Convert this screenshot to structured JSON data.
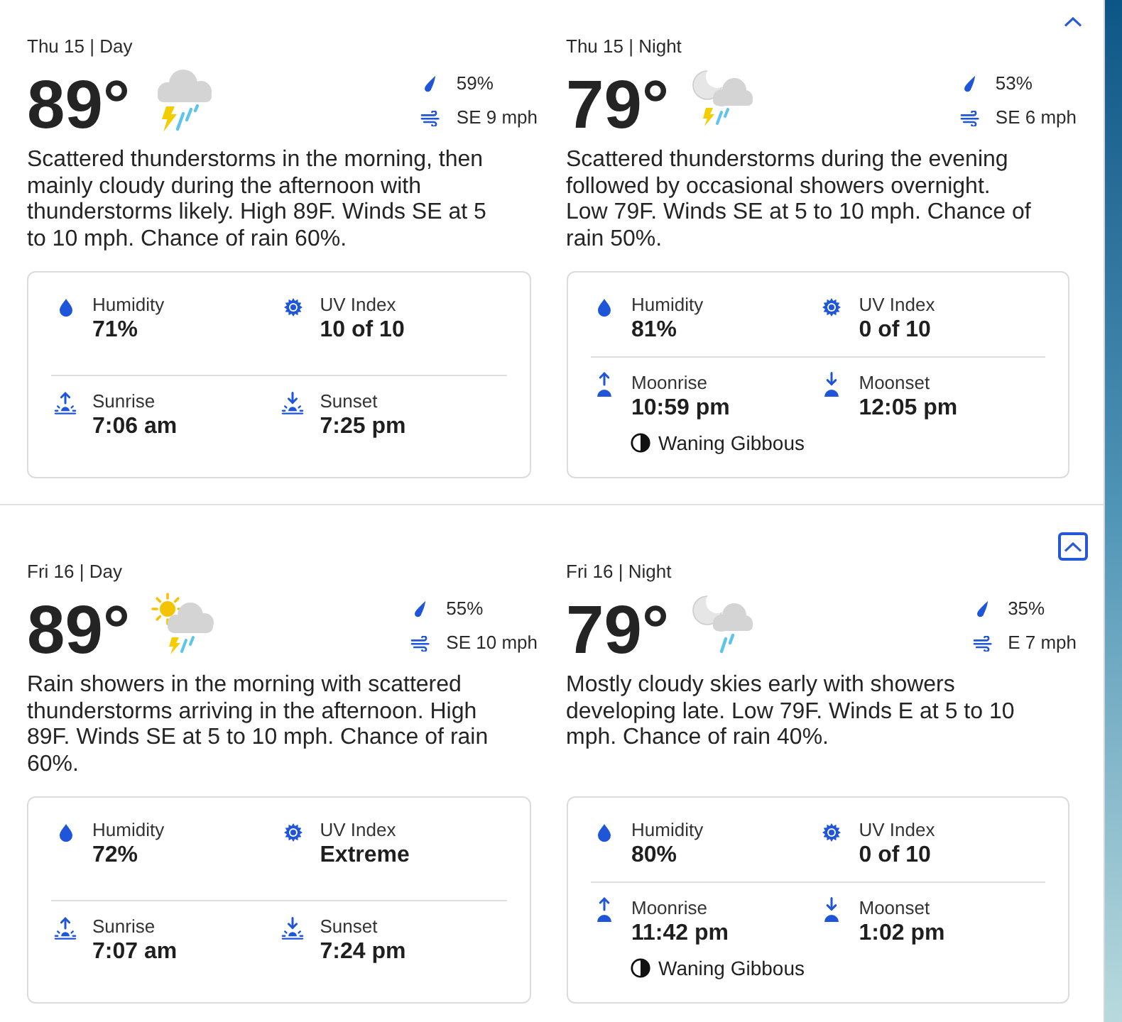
{
  "days": [
    {
      "collapse_button": {
        "focused": false
      },
      "periods": [
        {
          "title": "Thu 15 | Day",
          "temperature": "89°",
          "kind": "cloud-storm",
          "precipitation": "59%",
          "wind": "SE 9 mph",
          "description": "Scattered thunderstorms in the morning, then mainly cloudy during the afternoon with thunderstorms likely. High 89F. Winds SE at 5 to 10 mph. Chance of rain 60%.",
          "details": [
            {
              "kind": "humidity",
              "label": "Humidity",
              "value": "71%"
            },
            {
              "kind": "uv",
              "label": "UV Index",
              "value": "10 of 10"
            },
            {
              "kind": "sunrise",
              "label": "Sunrise",
              "value": "7:06 am"
            },
            {
              "kind": "sunset",
              "label": "Sunset",
              "value": "7:25 pm"
            }
          ]
        },
        {
          "title": "Thu 15 | Night",
          "temperature": "79°",
          "kind": "moon-cloud-storm",
          "precipitation": "53%",
          "wind": "SE 6 mph",
          "description": "Scattered thunderstorms during the evening followed by occasional showers overnight. Low 79F. Winds SE at 5 to 10 mph. Chance of rain 50%.",
          "details": [
            {
              "kind": "humidity",
              "label": "Humidity",
              "value": "81%"
            },
            {
              "kind": "uv",
              "label": "UV Index",
              "value": "0 of 10"
            },
            {
              "kind": "moonrise",
              "label": "Moonrise",
              "value": "10:59 pm"
            },
            {
              "kind": "moonset",
              "label": "Moonset",
              "value": "12:05 pm"
            }
          ],
          "moon_phase": "Waning Gibbous"
        }
      ]
    },
    {
      "collapse_button": {
        "focused": true
      },
      "periods": [
        {
          "title": "Fri 16 | Day",
          "temperature": "89°",
          "kind": "sun-cloud-storm",
          "precipitation": "55%",
          "wind": "SE 10 mph",
          "description": "Rain showers in the morning with scattered thunderstorms arriving in the afternoon. High 89F. Winds SE at 5 to 10 mph. Chance of rain 60%.",
          "details": [
            {
              "kind": "humidity",
              "label": "Humidity",
              "value": "72%"
            },
            {
              "kind": "uv",
              "label": "UV Index",
              "value": "Extreme"
            },
            {
              "kind": "sunrise",
              "label": "Sunrise",
              "value": "7:07 am"
            },
            {
              "kind": "sunset",
              "label": "Sunset",
              "value": "7:24 pm"
            }
          ]
        },
        {
          "title": "Fri 16 | Night",
          "temperature": "79°",
          "kind": "moon-cloud-rain",
          "precipitation": "35%",
          "wind": "E 7 mph",
          "description": "Mostly cloudy skies early with showers developing late. Low 79F. Winds E at 5 to 10 mph. Chance of rain 40%.",
          "details": [
            {
              "kind": "humidity",
              "label": "Humidity",
              "value": "80%"
            },
            {
              "kind": "uv",
              "label": "UV Index",
              "value": "0 of 10"
            },
            {
              "kind": "moonrise",
              "label": "Moonrise",
              "value": "11:42 pm"
            },
            {
              "kind": "moonset",
              "label": "Moonset",
              "value": "1:02 pm"
            }
          ],
          "moon_phase": "Waning Gibbous"
        }
      ]
    }
  ]
}
